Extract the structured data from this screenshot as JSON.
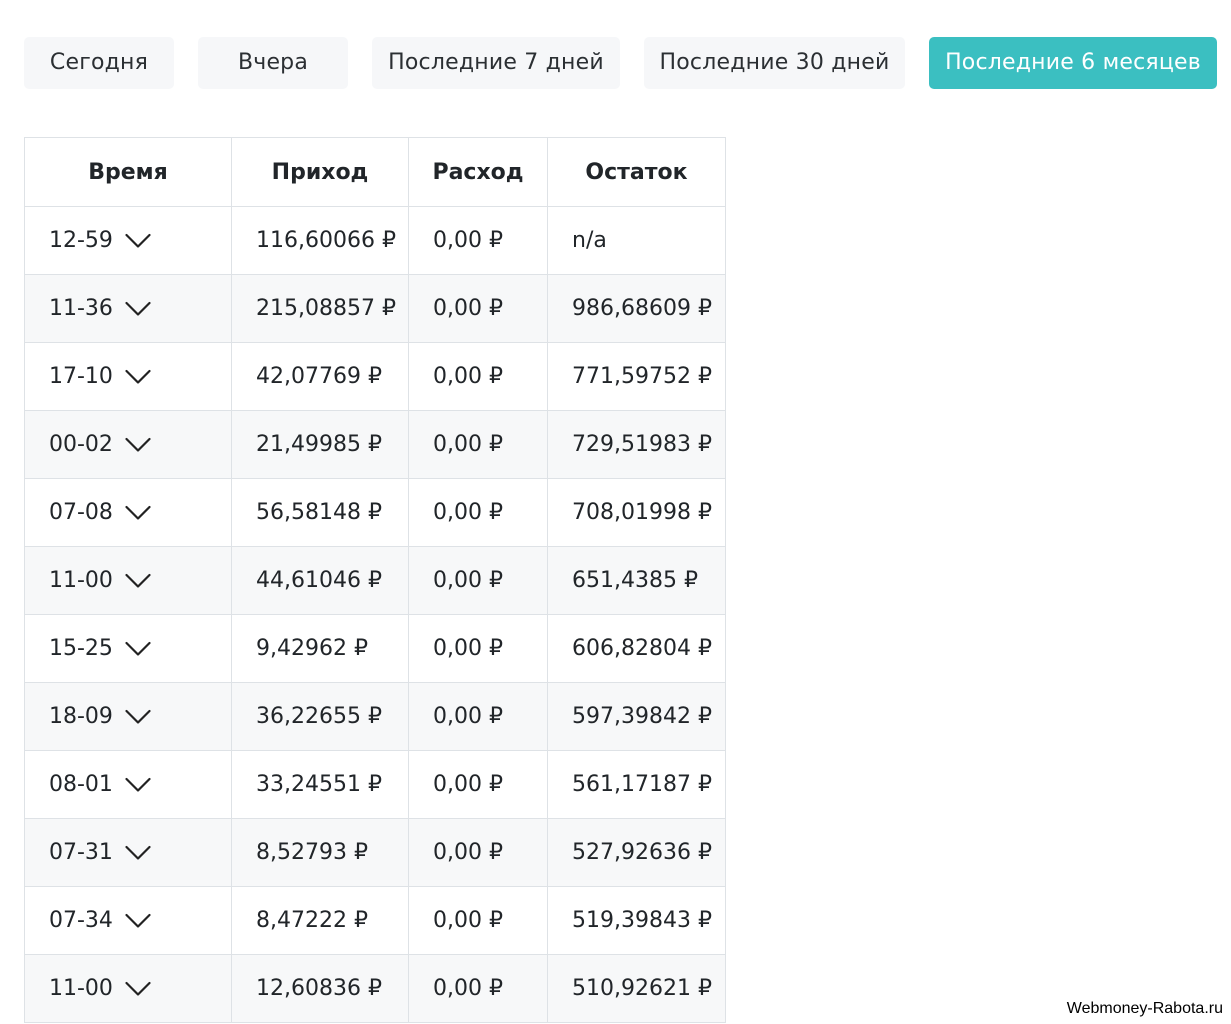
{
  "filters": [
    {
      "label": "Сегодня",
      "active": false
    },
    {
      "label": "Вчера",
      "active": false
    },
    {
      "label": "Последние 7 дней",
      "active": false
    },
    {
      "label": "Последние 30 дней",
      "active": false
    },
    {
      "label": "Последние 6 месяцев",
      "active": true
    }
  ],
  "colors": {
    "accent": "#3bbfc1",
    "filter_bg": "#f6f7f9",
    "row_alt_bg": "#f7f8f9",
    "border": "#dee2e6"
  },
  "table": {
    "headers": [
      "Время",
      "Приход",
      "Расход",
      "Остаток"
    ],
    "expand_icon": "chevron-down-icon",
    "rows": [
      {
        "time": "12-59",
        "income": "116,60066 ₽",
        "expense": "0,00 ₽",
        "balance": "n/a"
      },
      {
        "time": "11-36",
        "income": "215,08857 ₽",
        "expense": "0,00 ₽",
        "balance": "986,68609 ₽"
      },
      {
        "time": "17-10",
        "income": "42,07769 ₽",
        "expense": "0,00 ₽",
        "balance": "771,59752 ₽"
      },
      {
        "time": "00-02",
        "income": "21,49985 ₽",
        "expense": "0,00 ₽",
        "balance": "729,51983 ₽"
      },
      {
        "time": "07-08",
        "income": "56,58148 ₽",
        "expense": "0,00 ₽",
        "balance": "708,01998 ₽"
      },
      {
        "time": "11-00",
        "income": "44,61046 ₽",
        "expense": "0,00 ₽",
        "balance": "651,4385 ₽"
      },
      {
        "time": "15-25",
        "income": "9,42962 ₽",
        "expense": "0,00 ₽",
        "balance": "606,82804 ₽"
      },
      {
        "time": "18-09",
        "income": "36,22655 ₽",
        "expense": "0,00 ₽",
        "balance": "597,39842 ₽"
      },
      {
        "time": "08-01",
        "income": "33,24551 ₽",
        "expense": "0,00 ₽",
        "balance": "561,17187 ₽"
      },
      {
        "time": "07-31",
        "income": "8,52793 ₽",
        "expense": "0,00 ₽",
        "balance": "527,92636 ₽"
      },
      {
        "time": "07-34",
        "income": "8,47222 ₽",
        "expense": "0,00 ₽",
        "balance": "519,39843 ₽"
      },
      {
        "time": "11-00",
        "income": "12,60836 ₽",
        "expense": "0,00 ₽",
        "balance": "510,92621 ₽"
      }
    ]
  },
  "watermark": "Webmoney-Rabota.ru"
}
